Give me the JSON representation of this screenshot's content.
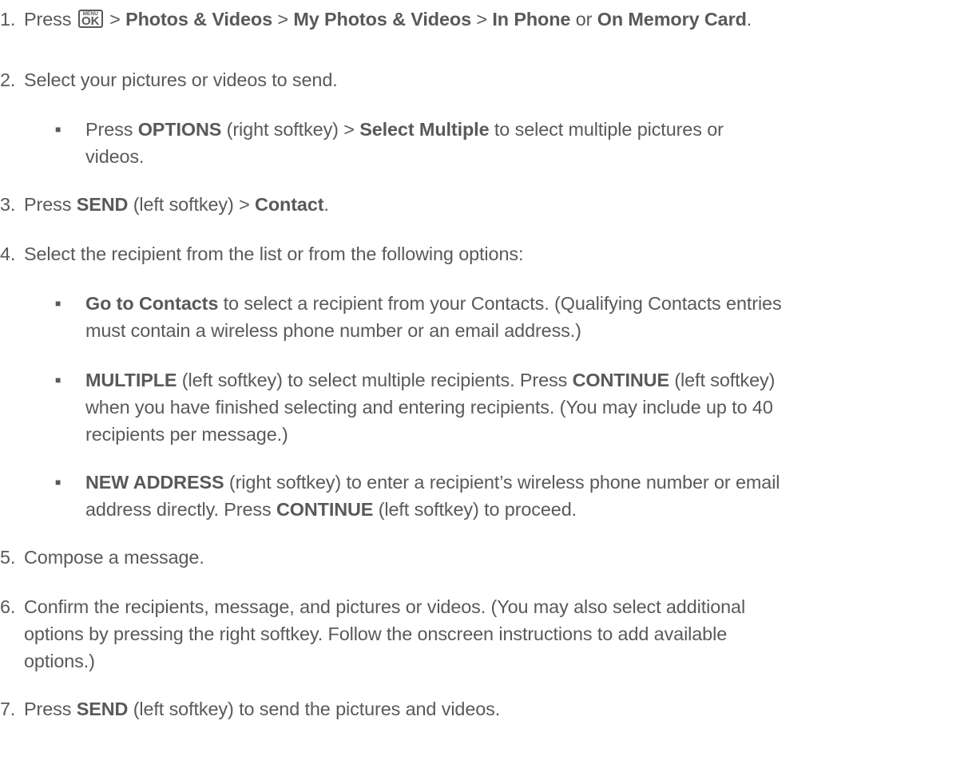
{
  "steps": [
    {
      "num": "1.",
      "pre": "Press ",
      "key_top": "MENU",
      "key_main": "OK",
      "parts": [
        " > ",
        "Photos & Videos",
        " > ",
        "My Photos & Videos",
        " > ",
        "In Phone",
        " or ",
        "On Memory Card",
        "."
      ]
    },
    {
      "num": "2.",
      "text": "Select your pictures or videos to send."
    },
    {
      "num": "3.",
      "parts": [
        "Press ",
        "SEND",
        " (left softkey) > ",
        "Contact",
        "."
      ]
    },
    {
      "num": "4.",
      "text": "Select the recipient from the list or from the following options:"
    },
    {
      "num": "5.",
      "text": "Compose a message."
    },
    {
      "num": "6.",
      "lines": [
        "Confirm the recipients, message, and pictures or videos. (You may also select additional",
        "options by pressing the right softkey. Follow the onscreen instructions to add available",
        "options.)"
      ]
    },
    {
      "num": "7.",
      "parts": [
        "Press ",
        "SEND",
        " (left softkey) to send the pictures and videos."
      ]
    }
  ],
  "bullet_glyph": "■",
  "sub_bullets": {
    "select_multiple": {
      "line1": [
        "Press ",
        "OPTIONS",
        " (right softkey) > ",
        "Select Multiple",
        " to select multiple pictures or"
      ],
      "line2": "videos."
    },
    "go_to_contacts": {
      "line1": [
        "Go to Contacts",
        " to select a recipient from your Contacts. (Qualifying Contacts entries"
      ],
      "line2": "must contain a wireless phone number or an email address.)"
    },
    "multiple": {
      "line1": [
        "MULTIPLE",
        " (left softkey) to select multiple recipients. Press ",
        "CONTINUE",
        " (left softkey)"
      ],
      "line2": "when you have finished selecting and entering recipients. (You may include up to 40",
      "line3": "recipients per message.)"
    },
    "new_address": {
      "line1": [
        "NEW ADDRESS",
        " (right softkey) to enter a recipient’s wireless phone number or email"
      ],
      "line2": [
        "address directly. Press ",
        "CONTINUE",
        " (left softkey) to proceed."
      ]
    }
  }
}
